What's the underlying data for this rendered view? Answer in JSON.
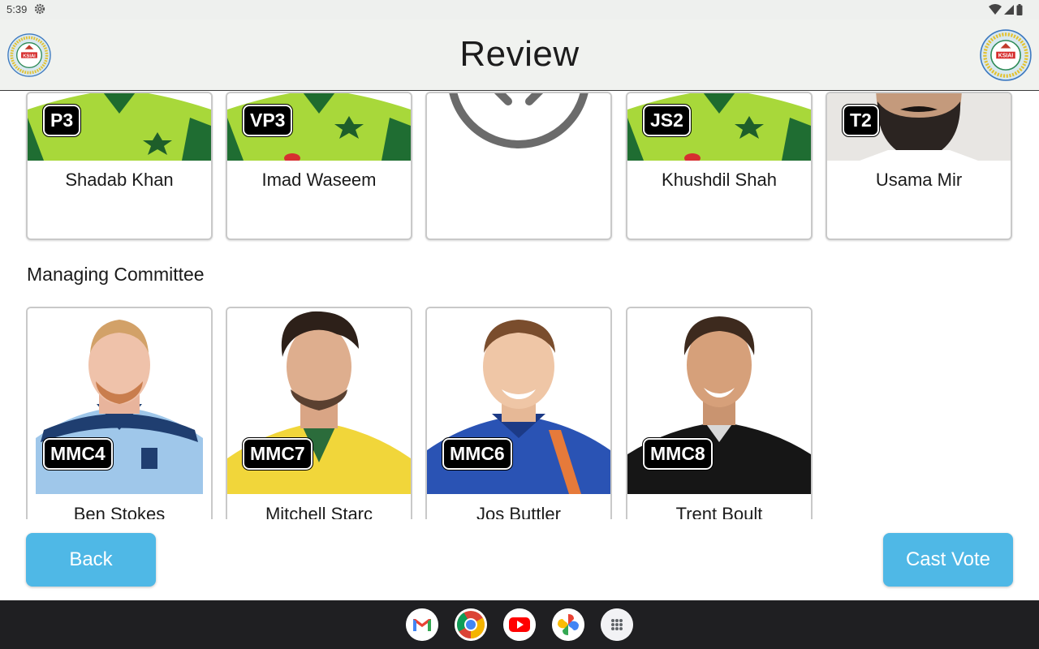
{
  "status_bar": {
    "time": "5:39"
  },
  "app_bar": {
    "title": "Review",
    "left_logo": "KSIAI",
    "right_logo": "KSIAI"
  },
  "top_row": [
    {
      "code": "P3",
      "name": "Shadab Khan",
      "jersey": "pakistan-green"
    },
    {
      "code": "VP3",
      "name": "Imad Waseem",
      "jersey": "pakistan-green"
    },
    {
      "code": "",
      "name": "",
      "jersey": "placeholder"
    },
    {
      "code": "JS2",
      "name": "Khushdil Shah",
      "jersey": "pakistan-green"
    },
    {
      "code": "T2",
      "name": "Usama Mir",
      "jersey": "white-shirt"
    }
  ],
  "managing_committee": {
    "title": "Managing Committee",
    "members": [
      {
        "code": "MMC4",
        "name": "Ben Stokes",
        "jersey": "england-blue"
      },
      {
        "code": "MMC7",
        "name": "Mitchell Starc",
        "jersey": "australia-yellow"
      },
      {
        "code": "MMC6",
        "name": "Jos Buttler",
        "jersey": "england-navy"
      },
      {
        "code": "MMC8",
        "name": "Trent Boult",
        "jersey": "nz-black"
      }
    ]
  },
  "buttons": {
    "back": "Back",
    "cast_vote": "Cast Vote"
  },
  "dock": [
    "gmail-icon",
    "chrome-icon",
    "youtube-icon",
    "photos-icon",
    "app-drawer-icon"
  ],
  "colors": {
    "button": "#4fb8e6",
    "badge": "#000000",
    "app_bar": "#f0f2ef",
    "nav_bar": "#1f1f22"
  }
}
